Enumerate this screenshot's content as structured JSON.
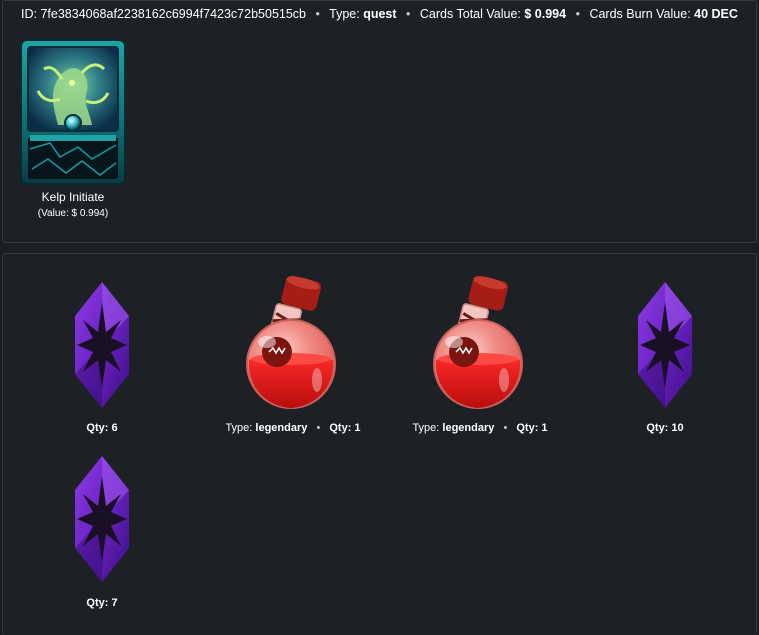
{
  "header": {
    "id_label": "ID:",
    "id_value": "7fe3834068af2238162c6994f7423c72b50515cb",
    "type_label": "Type:",
    "type_value": "quest",
    "total_label": "Cards Total Value:",
    "total_value": "$ 0.994",
    "burn_label": "Cards Burn Value:",
    "burn_value": "40 DEC"
  },
  "card": {
    "name": "Kelp Initiate",
    "value_label": "(Value: $ 0.994)"
  },
  "rewards": [
    {
      "kind": "crystal",
      "icon": "merit-crystal-icon",
      "qty_label": "Qty:",
      "qty": "6"
    },
    {
      "kind": "potion",
      "icon": "legendary-potion-icon",
      "type_label": "Type:",
      "type": "legendary",
      "qty_label": "Qty:",
      "qty": "1"
    },
    {
      "kind": "potion",
      "icon": "legendary-potion-icon",
      "type_label": "Type:",
      "type": "legendary",
      "qty_label": "Qty:",
      "qty": "1"
    },
    {
      "kind": "crystal",
      "icon": "merit-crystal-icon",
      "qty_label": "Qty:",
      "qty": "10"
    },
    {
      "kind": "crystal",
      "icon": "merit-crystal-icon",
      "qty_label": "Qty:",
      "qty": "7"
    }
  ]
}
